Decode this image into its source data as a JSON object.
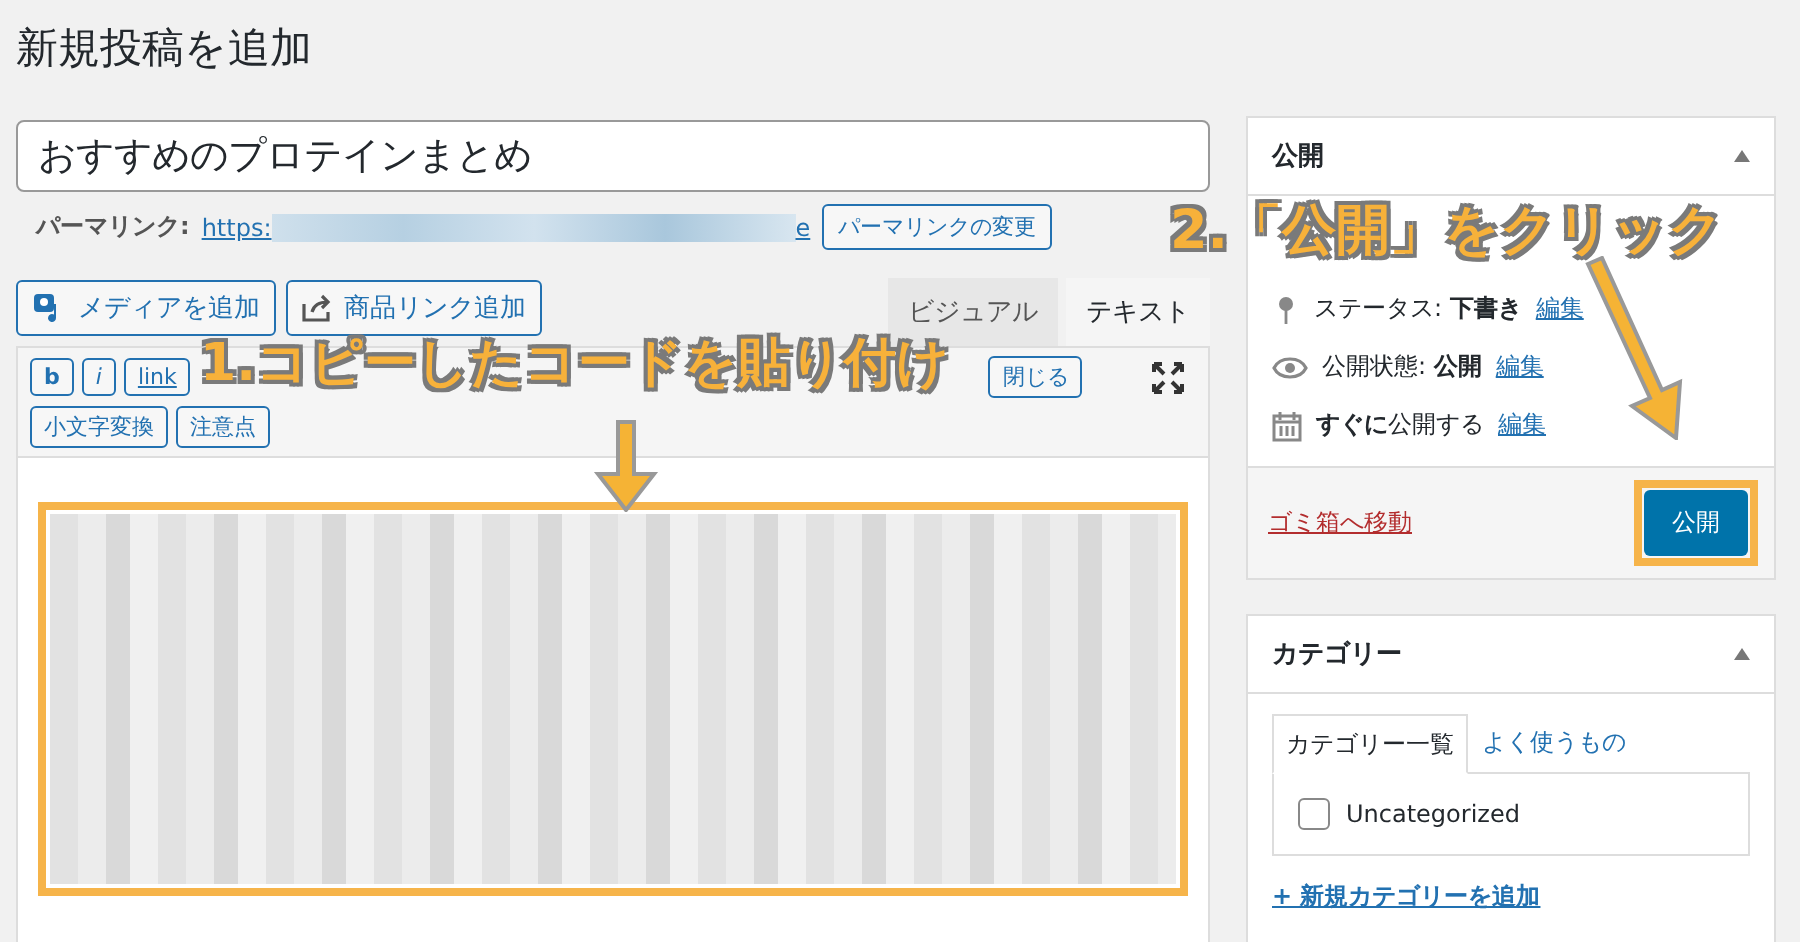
{
  "page_title": "新規投稿を追加",
  "post_title": "おすすめのプロテインまとめ",
  "permalink": {
    "label": "パーマリンク:",
    "url": "https:",
    "url_end": "e",
    "change_button": "パーマリンクの変更"
  },
  "media_buttons": [
    {
      "label": "メディアを追加",
      "kind": "media"
    },
    {
      "label": "商品リンク追加",
      "kind": "link"
    }
  ],
  "editor_tabs": [
    {
      "label": "ビジュアル",
      "selected": false
    },
    {
      "label": "テキスト",
      "selected": true
    }
  ],
  "toolbar": {
    "row_1": [
      {
        "label": "b",
        "kind": "bold"
      },
      {
        "label": "i",
        "kind": "italic"
      },
      {
        "label": "link",
        "kind": "link"
      }
    ],
    "close": "閉じる",
    "row_2": [
      "小文字変換",
      "注意点"
    ]
  },
  "publish_box": {
    "title": "公開",
    "status_label": "ステータス:",
    "status": "下書き",
    "visibility_label": "公開状態:",
    "visibility": "公開",
    "schedule": "**すぐに**公開する",
    "edit_links": [
      "編集",
      "編集",
      "編集"
    ],
    "trash": "ゴミ箱へ移動",
    "publish_button": "公開"
  },
  "category_box": {
    "title": "カテゴリー",
    "tabs": [
      {
        "label": "カテゴリー一覧",
        "selected": true
      },
      {
        "label": "よく使うもの",
        "selected": false
      }
    ],
    "categories": [
      {
        "label": "Uncategorized",
        "checked": false
      }
    ],
    "add_link": "+ 新規カテゴリーを追加"
  },
  "annotations": [
    {
      "text": "1.コピーしたコードを貼り付け"
    },
    {
      "text": "2.「公開」をクリック"
    }
  ]
}
